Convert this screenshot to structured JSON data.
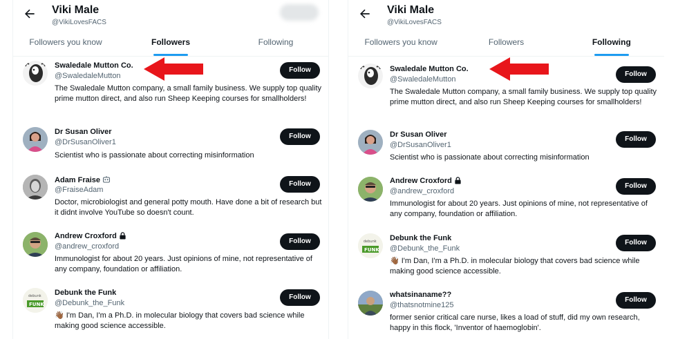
{
  "left": {
    "header": {
      "name": "Viki Male",
      "handle": "@VikiLovesFACS"
    },
    "tabs": [
      "Followers you know",
      "Followers",
      "Following"
    ],
    "users": [
      {
        "name": "Swaledale Mutton Co.",
        "handle": "@SwaledaleMutton",
        "bio": "The Swaledale Mutton company, a small family business. We supply top quality prime mutton direct, and also run Sheep Keeping courses for smallholders!",
        "button": "Follow"
      },
      {
        "name": "Dr Susan Oliver",
        "handle": "@DrSusanOliver1",
        "bio": "Scientist who is passionate about correcting misinformation",
        "button": "Follow"
      },
      {
        "name": "Adam Fraise",
        "handle": "@FraiseAdam",
        "bio": "Doctor, microbiologist and general potty mouth. Have done a bit of research but it didnt involve YouTube so doesn't count.",
        "button": "Follow"
      },
      {
        "name": "Andrew Croxford",
        "handle": "@andrew_croxford",
        "bio": "Immunologist for about 20 years. Just opinions of mine, not representative of any company, foundation or affiliation.",
        "button": "Follow"
      },
      {
        "name": "Debunk the Funk",
        "handle": "@Debunk_the_Funk",
        "bio": "👋🏾 I'm Dan, I'm a Ph.D. in molecular biology that covers bad science while making good science accessible.",
        "button": "Follow"
      }
    ]
  },
  "right": {
    "header": {
      "name": "Viki Male",
      "handle": "@VikiLovesFACS"
    },
    "tabs": [
      "Followers you know",
      "Followers",
      "Following"
    ],
    "users": [
      {
        "name": "Swaledale Mutton Co.",
        "handle": "@SwaledaleMutton",
        "bio": "The Swaledale Mutton company, a small family business. We supply top quality prime mutton direct, and also run Sheep Keeping courses for smallholders!",
        "button": "Follow"
      },
      {
        "name": "Dr Susan Oliver",
        "handle": "@DrSusanOliver1",
        "bio": "Scientist who is passionate about correcting misinformation",
        "button": "Follow"
      },
      {
        "name": "Andrew Croxford",
        "handle": "@andrew_croxford",
        "bio": "Immunologist for about 20 years. Just opinions of mine, not representative of any company, foundation or affiliation.",
        "button": "Follow"
      },
      {
        "name": "Debunk the Funk",
        "handle": "@Debunk_the_Funk",
        "bio": "👋🏾 I'm Dan, I'm a Ph.D. in molecular biology that covers bad science while making good science accessible.",
        "button": "Follow"
      },
      {
        "name": "whatsinaname??",
        "handle": "@thatsnotmine125",
        "bio": "former senior critical care nurse, likes a load of stuff, did my own research, happy in this flock, 'Inventor of haemoglobin'.",
        "button": "Follow"
      }
    ]
  },
  "colors": {
    "accent": "#1d9bf0",
    "arrow": "#e8161b",
    "button": "#0f1419"
  },
  "icons": {
    "back": "arrow-left-icon",
    "robot_badge": "robot-icon",
    "lock_badge": "lock-icon"
  }
}
